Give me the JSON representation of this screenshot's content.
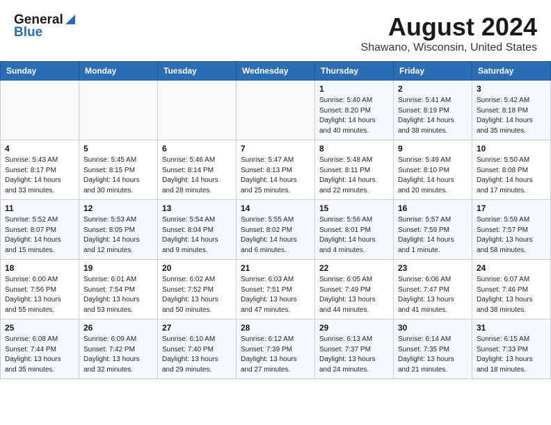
{
  "header": {
    "logo_general": "General",
    "logo_blue": "Blue",
    "title": "August 2024",
    "location": "Shawano, Wisconsin, United States"
  },
  "days_of_week": [
    "Sunday",
    "Monday",
    "Tuesday",
    "Wednesday",
    "Thursday",
    "Friday",
    "Saturday"
  ],
  "weeks": [
    [
      {
        "day": "",
        "info": ""
      },
      {
        "day": "",
        "info": ""
      },
      {
        "day": "",
        "info": ""
      },
      {
        "day": "",
        "info": ""
      },
      {
        "day": "1",
        "info": "Sunrise: 5:40 AM\nSunset: 8:20 PM\nDaylight: 14 hours\nand 40 minutes."
      },
      {
        "day": "2",
        "info": "Sunrise: 5:41 AM\nSunset: 8:19 PM\nDaylight: 14 hours\nand 38 minutes."
      },
      {
        "day": "3",
        "info": "Sunrise: 5:42 AM\nSunset: 8:18 PM\nDaylight: 14 hours\nand 35 minutes."
      }
    ],
    [
      {
        "day": "4",
        "info": "Sunrise: 5:43 AM\nSunset: 8:17 PM\nDaylight: 14 hours\nand 33 minutes."
      },
      {
        "day": "5",
        "info": "Sunrise: 5:45 AM\nSunset: 8:15 PM\nDaylight: 14 hours\nand 30 minutes."
      },
      {
        "day": "6",
        "info": "Sunrise: 5:46 AM\nSunset: 8:14 PM\nDaylight: 14 hours\nand 28 minutes."
      },
      {
        "day": "7",
        "info": "Sunrise: 5:47 AM\nSunset: 8:13 PM\nDaylight: 14 hours\nand 25 minutes."
      },
      {
        "day": "8",
        "info": "Sunrise: 5:48 AM\nSunset: 8:11 PM\nDaylight: 14 hours\nand 22 minutes."
      },
      {
        "day": "9",
        "info": "Sunrise: 5:49 AM\nSunset: 8:10 PM\nDaylight: 14 hours\nand 20 minutes."
      },
      {
        "day": "10",
        "info": "Sunrise: 5:50 AM\nSunset: 8:08 PM\nDaylight: 14 hours\nand 17 minutes."
      }
    ],
    [
      {
        "day": "11",
        "info": "Sunrise: 5:52 AM\nSunset: 8:07 PM\nDaylight: 14 hours\nand 15 minutes."
      },
      {
        "day": "12",
        "info": "Sunrise: 5:53 AM\nSunset: 8:05 PM\nDaylight: 14 hours\nand 12 minutes."
      },
      {
        "day": "13",
        "info": "Sunrise: 5:54 AM\nSunset: 8:04 PM\nDaylight: 14 hours\nand 9 minutes."
      },
      {
        "day": "14",
        "info": "Sunrise: 5:55 AM\nSunset: 8:02 PM\nDaylight: 14 hours\nand 6 minutes."
      },
      {
        "day": "15",
        "info": "Sunrise: 5:56 AM\nSunset: 8:01 PM\nDaylight: 14 hours\nand 4 minutes."
      },
      {
        "day": "16",
        "info": "Sunrise: 5:57 AM\nSunset: 7:59 PM\nDaylight: 14 hours\nand 1 minute."
      },
      {
        "day": "17",
        "info": "Sunrise: 5:59 AM\nSunset: 7:57 PM\nDaylight: 13 hours\nand 58 minutes."
      }
    ],
    [
      {
        "day": "18",
        "info": "Sunrise: 6:00 AM\nSunset: 7:56 PM\nDaylight: 13 hours\nand 55 minutes."
      },
      {
        "day": "19",
        "info": "Sunrise: 6:01 AM\nSunset: 7:54 PM\nDaylight: 13 hours\nand 53 minutes."
      },
      {
        "day": "20",
        "info": "Sunrise: 6:02 AM\nSunset: 7:52 PM\nDaylight: 13 hours\nand 50 minutes."
      },
      {
        "day": "21",
        "info": "Sunrise: 6:03 AM\nSunset: 7:51 PM\nDaylight: 13 hours\nand 47 minutes."
      },
      {
        "day": "22",
        "info": "Sunrise: 6:05 AM\nSunset: 7:49 PM\nDaylight: 13 hours\nand 44 minutes."
      },
      {
        "day": "23",
        "info": "Sunrise: 6:06 AM\nSunset: 7:47 PM\nDaylight: 13 hours\nand 41 minutes."
      },
      {
        "day": "24",
        "info": "Sunrise: 6:07 AM\nSunset: 7:46 PM\nDaylight: 13 hours\nand 38 minutes."
      }
    ],
    [
      {
        "day": "25",
        "info": "Sunrise: 6:08 AM\nSunset: 7:44 PM\nDaylight: 13 hours\nand 35 minutes."
      },
      {
        "day": "26",
        "info": "Sunrise: 6:09 AM\nSunset: 7:42 PM\nDaylight: 13 hours\nand 32 minutes."
      },
      {
        "day": "27",
        "info": "Sunrise: 6:10 AM\nSunset: 7:40 PM\nDaylight: 13 hours\nand 29 minutes."
      },
      {
        "day": "28",
        "info": "Sunrise: 6:12 AM\nSunset: 7:39 PM\nDaylight: 13 hours\nand 27 minutes."
      },
      {
        "day": "29",
        "info": "Sunrise: 6:13 AM\nSunset: 7:37 PM\nDaylight: 13 hours\nand 24 minutes."
      },
      {
        "day": "30",
        "info": "Sunrise: 6:14 AM\nSunset: 7:35 PM\nDaylight: 13 hours\nand 21 minutes."
      },
      {
        "day": "31",
        "info": "Sunrise: 6:15 AM\nSunset: 7:33 PM\nDaylight: 13 hours\nand 18 minutes."
      }
    ]
  ]
}
